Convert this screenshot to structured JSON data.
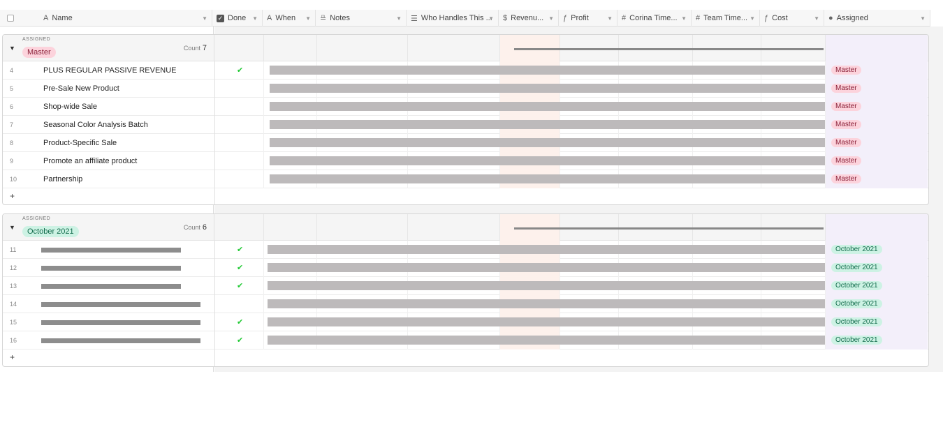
{
  "columns": [
    {
      "label": "Name",
      "icon": "text-icon",
      "glyph": "A"
    },
    {
      "label": "Done",
      "icon": "checkbox-icon",
      "glyph": "✓"
    },
    {
      "label": "When",
      "icon": "text-icon",
      "glyph": "A"
    },
    {
      "label": "Notes",
      "icon": "long-text-icon",
      "glyph": "≞"
    },
    {
      "label": "Who Handles This ...",
      "icon": "multi-select-icon",
      "glyph": "☰"
    },
    {
      "label": "Revenu...",
      "icon": "currency-icon",
      "glyph": "$"
    },
    {
      "label": "Profit",
      "icon": "formula-icon",
      "glyph": "ƒ"
    },
    {
      "label": "Corina Time...",
      "icon": "number-icon",
      "glyph": "#"
    },
    {
      "label": "Team Time...",
      "icon": "number-icon",
      "glyph": "#"
    },
    {
      "label": "Cost",
      "icon": "formula-icon",
      "glyph": "ƒ"
    },
    {
      "label": "Assigned",
      "icon": "single-select-icon",
      "glyph": "●"
    }
  ],
  "groups": [
    {
      "label": "ASSIGNED",
      "value": "Master",
      "count_label": "Count",
      "count": "7",
      "rows": [
        {
          "num": "4",
          "name": "PLUS REGULAR PASSIVE REVENUE",
          "done": true,
          "assigned": "Master"
        },
        {
          "num": "5",
          "name": "Pre-Sale New Product",
          "done": false,
          "assigned": "Master"
        },
        {
          "num": "6",
          "name": "Shop-wide Sale",
          "done": false,
          "assigned": "Master"
        },
        {
          "num": "7",
          "name": "Seasonal Color Analysis Batch",
          "done": false,
          "assigned": "Master"
        },
        {
          "num": "8",
          "name": "Product-Specific Sale",
          "done": false,
          "assigned": "Master"
        },
        {
          "num": "9",
          "name": "Promote an affiliate product",
          "done": false,
          "assigned": "Master"
        },
        {
          "num": "10",
          "name": "Partnership",
          "done": false,
          "assigned": "Master"
        }
      ]
    },
    {
      "label": "ASSIGNED",
      "value": "October 2021",
      "count_label": "Count",
      "count": "6",
      "rows": [
        {
          "num": "11",
          "name": "",
          "done": true,
          "assigned": "October 2021"
        },
        {
          "num": "12",
          "name": "",
          "done": true,
          "assigned": "October 2021"
        },
        {
          "num": "13",
          "name": "",
          "done": true,
          "assigned": "October 2021"
        },
        {
          "num": "14",
          "name": "",
          "done": false,
          "assigned": "October 2021"
        },
        {
          "num": "15",
          "name": "",
          "done": true,
          "assigned": "October 2021"
        },
        {
          "num": "16",
          "name": "",
          "done": true,
          "assigned": "October 2021"
        }
      ]
    }
  ],
  "add_row_symbol": "+",
  "check_symbol": "✔",
  "colors": {
    "master_pill": "#fcd3dc",
    "october_pill": "#cdf2e4",
    "done_check": "#20c933",
    "redaction": "#bdbabb"
  }
}
